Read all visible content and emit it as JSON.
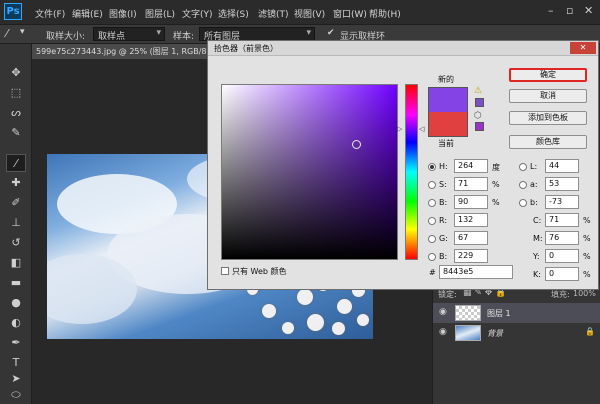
{
  "menubar": {
    "logo": "Ps",
    "items": [
      "文件(F)",
      "编辑(E)",
      "图像(I)",
      "图层(L)",
      "文字(Y)",
      "选择(S)",
      "滤镜(T)",
      "视图(V)",
      "窗口(W)",
      "帮助(H)"
    ]
  },
  "optionsbar": {
    "sample_size_label": "取样大小:",
    "sample_size_value": "取样点",
    "sample_label": "样本:",
    "sample_value": "所有图层",
    "show_ring_label": "显示取样环"
  },
  "document": {
    "tab_title": "599e75c273443.jpg @ 25% (图层 1, RGB/8#)"
  },
  "layers_panel": {
    "lock_label": "锁定:",
    "fill_label": "填充:",
    "fill_value": "100%",
    "layers": [
      {
        "name": "图层 1"
      },
      {
        "name": "背景"
      }
    ]
  },
  "picker": {
    "title": "拾色器（前景色）",
    "new_label": "新的",
    "current_label": "当前",
    "buttons": {
      "ok": "确定",
      "cancel": "取消",
      "add_swatch": "添加到色板",
      "library": "颜色库"
    },
    "hsb": {
      "h": "264",
      "s": "71",
      "b": "90"
    },
    "rgb": {
      "r": "132",
      "g": "67",
      "b": "229"
    },
    "lab": {
      "l": "44",
      "a": "53",
      "b": "-73"
    },
    "cmyk": {
      "c": "71",
      "m": "76",
      "y": "0",
      "k": "0"
    },
    "hex": "8443e5",
    "units": {
      "degree": "度",
      "percent": "%"
    },
    "labels": {
      "h": "H:",
      "s": "S:",
      "bri": "B:",
      "r": "R:",
      "g": "G:",
      "b": "B:",
      "l": "L:",
      "a": "a:",
      "lab_b": "b:",
      "c": "C:",
      "m": "M:",
      "y": "Y:",
      "k": "K:",
      "hex": "#"
    },
    "web_only_label": "只有 Web 颜色",
    "new_color": "#8443e5",
    "current_color": "#e04040",
    "hue_color": "#7000ff"
  }
}
